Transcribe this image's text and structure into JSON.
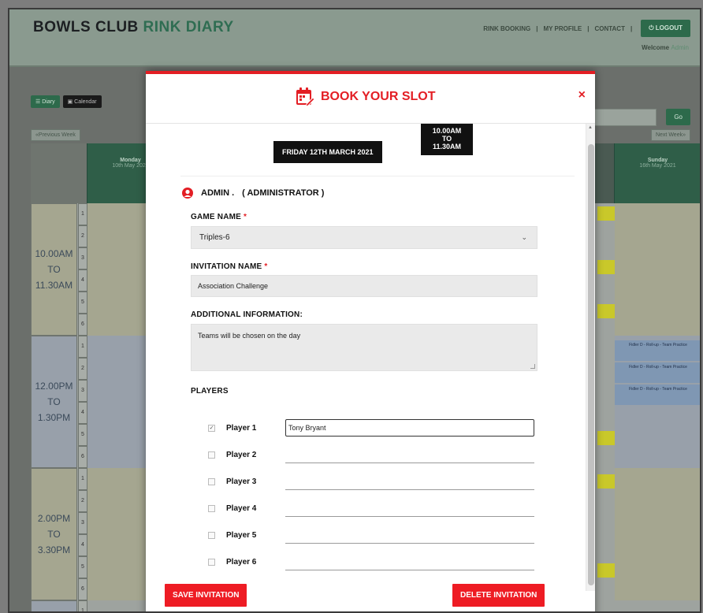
{
  "app": {
    "brand_main": "BOWLS CLUB",
    "brand_accent": "RINK DIARY"
  },
  "nav": {
    "items": [
      "RINK BOOKING",
      "MY PROFILE",
      "CONTACT"
    ],
    "logout": "LOGOUT",
    "welcome_prefix": "Welcome",
    "welcome_user": "Admin"
  },
  "toolbar": {
    "diary": "Diary",
    "calendar": "Calendar",
    "go": "Go",
    "previous_week": "Previous Week",
    "next_week": "Next Week"
  },
  "grid": {
    "columns": [
      {
        "day": "Monday",
        "date": "10th May 2021"
      },
      {
        "day": "Sunday",
        "date": "16th May 2021"
      }
    ],
    "time_slots": [
      {
        "start": "10.00AM",
        "to": "TO",
        "end": "11.30AM"
      },
      {
        "start": "12.00PM",
        "to": "TO",
        "end": "1.30PM"
      },
      {
        "start": "2.00PM",
        "to": "TO",
        "end": "3.30PM"
      }
    ],
    "rows": [
      "1",
      "2",
      "3",
      "4",
      "5",
      "6"
    ],
    "practice_label": "Fidler D - Roll-up - Team Practice"
  },
  "modal": {
    "title": "BOOK YOUR SLOT",
    "close": "×",
    "date": "FRIDAY 12TH MARCH 2021",
    "time_line1": "10.00AM",
    "time_line2": "TO",
    "time_line3": "11.30AM",
    "user_name": "ADMIN .",
    "user_role": "( ADMINISTRATOR )",
    "game_name_label": "GAME NAME",
    "game_name_value": "Triples-6",
    "invitation_name_label": "INVITATION NAME",
    "invitation_name_value": "Association Challenge",
    "additional_info_label": "ADDITIONAL INFORMATION:",
    "additional_info_value": "Teams will be chosen on the day",
    "required_mark": "*",
    "players_label": "PLAYERS",
    "players": [
      {
        "label": "Player 1",
        "value": "Tony Bryant",
        "checked": true
      },
      {
        "label": "Player 2",
        "value": "",
        "checked": false
      },
      {
        "label": "Player 3",
        "value": "",
        "checked": false
      },
      {
        "label": "Player 4",
        "value": "",
        "checked": false
      },
      {
        "label": "Player 5",
        "value": "",
        "checked": false
      },
      {
        "label": "Player 6",
        "value": "",
        "checked": false
      }
    ],
    "save_button": "SAVE INVITATION",
    "delete_button": "DELETE INVITATION"
  },
  "colors": {
    "accent_red": "#e31e24",
    "brand_green": "#2d6a4b"
  }
}
